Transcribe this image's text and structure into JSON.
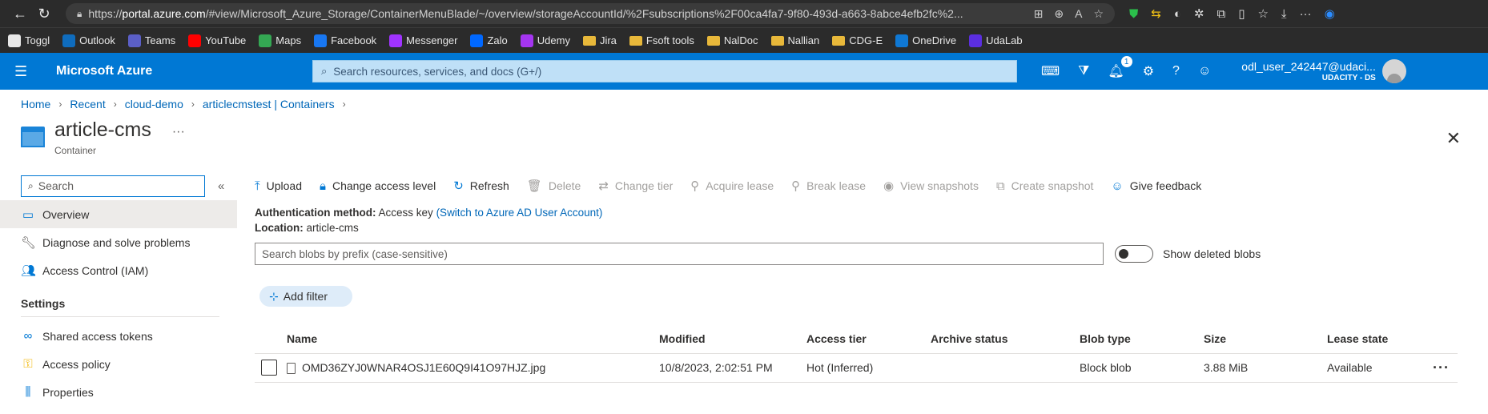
{
  "browser": {
    "url_prefix": "https://",
    "url_host": "portal.azure.com",
    "url_path": "/#view/Microsoft_Azure_Storage/ContainerMenuBlade/~/overview/storageAccountId/%2Fsubscriptions%2F00ca4fa7-9f80-493d-a663-8abce4efb2fc%2...",
    "bookmarks": [
      {
        "label": "Toggl",
        "icon": "toggl-icon",
        "color": "#e8e8e8"
      },
      {
        "label": "Outlook",
        "icon": "outlook-icon",
        "color": "#0f6cbd"
      },
      {
        "label": "Teams",
        "icon": "teams-icon",
        "color": "#5b5fc7"
      },
      {
        "label": "YouTube",
        "icon": "youtube-icon",
        "color": "#ff0000"
      },
      {
        "label": "Maps",
        "icon": "maps-icon",
        "color": "#34a853"
      },
      {
        "label": "Facebook",
        "icon": "facebook-icon",
        "color": "#1877f2"
      },
      {
        "label": "Messenger",
        "icon": "messenger-icon",
        "color": "#a033ff"
      },
      {
        "label": "Zalo",
        "icon": "zalo-icon",
        "color": "#0068ff"
      },
      {
        "label": "Udemy",
        "icon": "udemy-icon",
        "color": "#a435f0"
      },
      {
        "label": "Jira",
        "icon": "folder-icon",
        "color": "#e8b83a"
      },
      {
        "label": "Fsoft tools",
        "icon": "folder-icon",
        "color": "#e8b83a"
      },
      {
        "label": "NalDoc",
        "icon": "folder-icon",
        "color": "#e8b83a"
      },
      {
        "label": "Nallian",
        "icon": "folder-icon",
        "color": "#e8b83a"
      },
      {
        "label": "CDG-E",
        "icon": "folder-icon",
        "color": "#e8b83a"
      },
      {
        "label": "OneDrive",
        "icon": "onedrive-icon",
        "color": "#0f78d4"
      },
      {
        "label": "UdaLab",
        "icon": "udalab-icon",
        "color": "#5b2ee0"
      }
    ]
  },
  "azure": {
    "brand": "Microsoft Azure",
    "search_placeholder": "Search resources, services, and docs (G+/)",
    "notification_count": "1",
    "user_name": "odl_user_242447@udaci...",
    "user_tenant": "UDACITY - DS"
  },
  "breadcrumb": [
    "Home",
    "Recent",
    "cloud-demo",
    "articlecmstest | Containers"
  ],
  "header": {
    "title": "article-cms",
    "subtitle": "Container",
    "more": "···"
  },
  "sidebar": {
    "search_placeholder": "Search",
    "items": [
      {
        "label": "Overview",
        "icon": "overview-icon"
      },
      {
        "label": "Diagnose and solve problems",
        "icon": "wrench-icon"
      },
      {
        "label": "Access Control (IAM)",
        "icon": "people-icon"
      }
    ],
    "settings_header": "Settings",
    "settings_items": [
      {
        "label": "Shared access tokens",
        "icon": "link-icon"
      },
      {
        "label": "Access policy",
        "icon": "key-icon"
      },
      {
        "label": "Properties",
        "icon": "properties-icon"
      }
    ]
  },
  "toolbar": {
    "upload": "Upload",
    "change_access": "Change access level",
    "refresh": "Refresh",
    "delete": "Delete",
    "change_tier": "Change tier",
    "acquire_lease": "Acquire lease",
    "break_lease": "Break lease",
    "view_snapshots": "View snapshots",
    "create_snapshot": "Create snapshot",
    "give_feedback": "Give feedback"
  },
  "info": {
    "auth_label": "Authentication method:",
    "auth_value": "Access key",
    "auth_link": "(Switch to Azure AD User Account)",
    "location_label": "Location:",
    "location_value": "article-cms"
  },
  "blob_search": {
    "placeholder": "Search blobs by prefix (case-sensitive)",
    "show_deleted_label": "Show deleted blobs"
  },
  "filter": {
    "add_label": "Add filter"
  },
  "table": {
    "columns": [
      "Name",
      "Modified",
      "Access tier",
      "Archive status",
      "Blob type",
      "Size",
      "Lease state"
    ],
    "rows": [
      {
        "name": "OMD36ZYJ0WNAR4OSJ1E60Q9I41O97HJZ.jpg",
        "modified": "10/8/2023, 2:02:51 PM",
        "access_tier": "Hot (Inferred)",
        "archive_status": "",
        "blob_type": "Block blob",
        "size": "3.88 MiB",
        "lease_state": "Available"
      }
    ]
  }
}
